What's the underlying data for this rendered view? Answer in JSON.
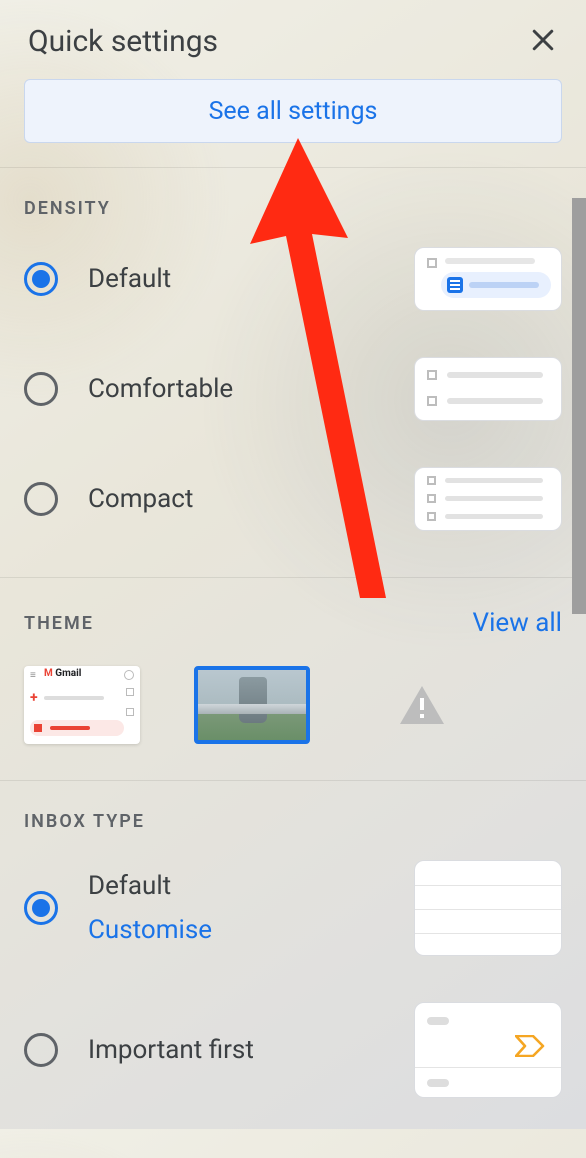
{
  "header": {
    "title": "Quick settings"
  },
  "see_all_button": "See all settings",
  "density": {
    "section_label": "DENSITY",
    "options": {
      "default": "Default",
      "comfortable": "Comfortable",
      "compact": "Compact"
    }
  },
  "theme": {
    "section_label": "THEME",
    "view_all": "View all",
    "thumb_a_brand": "Gmail"
  },
  "inbox_type": {
    "section_label": "INBOX TYPE",
    "options": {
      "default_label": "Default",
      "default_customise": "Customise",
      "important_first": "Important first"
    }
  }
}
